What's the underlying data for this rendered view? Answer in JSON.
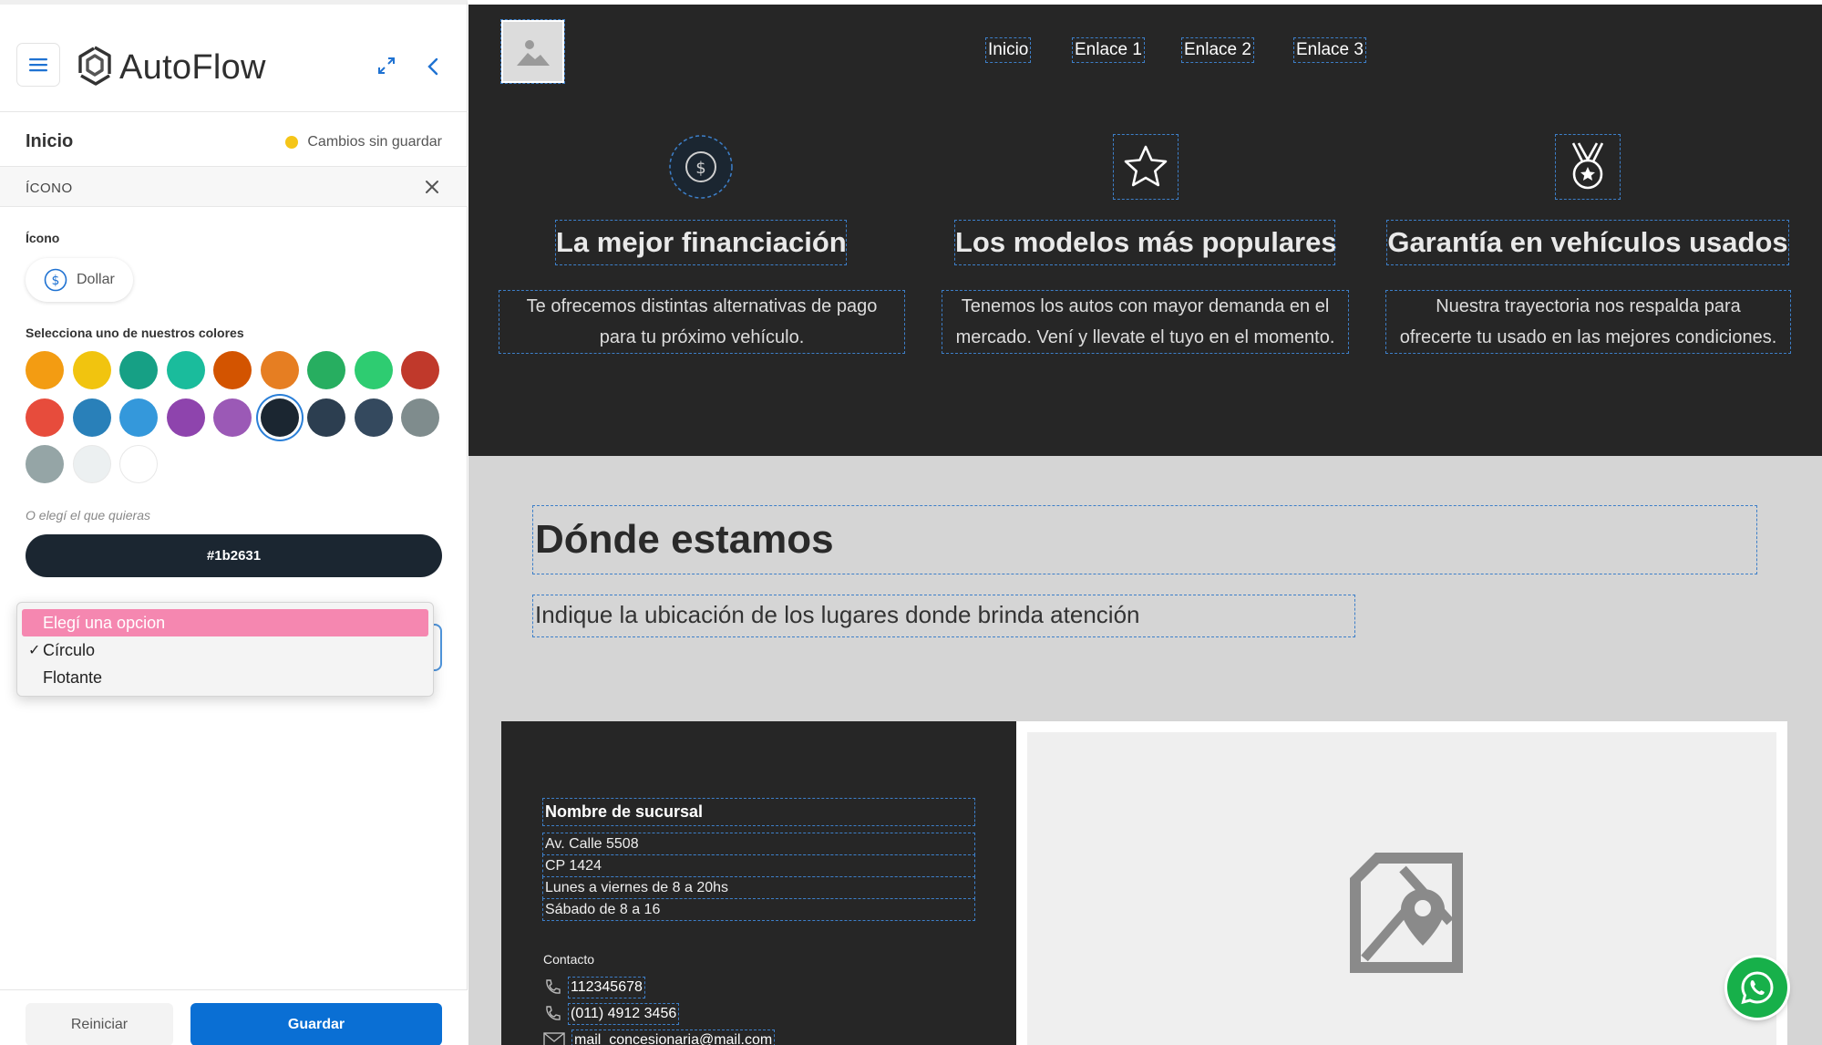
{
  "app": {
    "brand": "AutoFlow"
  },
  "sidebar": {
    "section_title": "Inicio",
    "unsaved_status": "Cambios sin guardar",
    "component_label": "ÍCONO",
    "icon_field_label": "Ícono",
    "icon_value": "Dollar",
    "colors_label": "Selecciona uno de nuestros colores",
    "swatches": [
      "#f39c12",
      "#f1c40f",
      "#16a085",
      "#1abc9c",
      "#d35400",
      "#e67e22",
      "#27ae60",
      "#2ecc71",
      "#c0392b",
      "#e74c3c",
      "#2980b9",
      "#3498db",
      "#8e44ad",
      "#9b59b6",
      "#1b2631",
      "#2c3e50",
      "#34495e",
      "#7f8c8d",
      "#95a5a6",
      "#ecf0f1",
      "#ffffff"
    ],
    "selected_swatch": "#1b2631",
    "custom_color_hint": "O elegí el que quieras",
    "custom_color_value": "#1b2631",
    "dropdown": {
      "options": [
        "Elegí una opcion",
        "Círculo",
        "Flotante"
      ],
      "highlighted": "Elegí una opcion",
      "checked": "Círculo"
    },
    "reset_label": "Reiniciar",
    "save_label": "Guardar"
  },
  "preview": {
    "nav": [
      "Inicio",
      "Enlace 1",
      "Enlace 2",
      "Enlace 3"
    ],
    "features": [
      {
        "icon": "dollar-circle-icon",
        "title": "La mejor financiación",
        "line1": "Te ofrecemos distintas alternativas de pago",
        "line2": "para tu próximo vehículo."
      },
      {
        "icon": "star-icon",
        "title": "Los modelos más populares",
        "line1": "Tenemos los autos con mayor demanda en el",
        "line2": "mercado. Vení y llevate el tuyo en el momento."
      },
      {
        "icon": "medal-icon",
        "title": "Garantía en vehículos usados",
        "line1": "Nuestra trayectoria nos respalda para",
        "line2": "ofrecerte tu usado en las mejores condiciones."
      }
    ],
    "location_title": "Dónde estamos",
    "location_subtitle": "Indique la ubicación de los lugares donde brinda atención",
    "branch": {
      "name": "Nombre de sucursal",
      "address_lines": [
        "Av. Calle 5508",
        "CP 1424",
        "Lunes a viernes de 8 a 20hs",
        "Sábado de 8 a 16"
      ],
      "contact_label": "Contacto",
      "phone1": "112345678",
      "phone2": "(011) 4912 3456",
      "email": "mail_concesionaria@mail.com"
    }
  },
  "colors": {
    "accent_blue": "#0a6fd4",
    "highlight_pink": "#f587b0",
    "whatsapp_green": "#17b04a",
    "dark_section": "#262626"
  }
}
